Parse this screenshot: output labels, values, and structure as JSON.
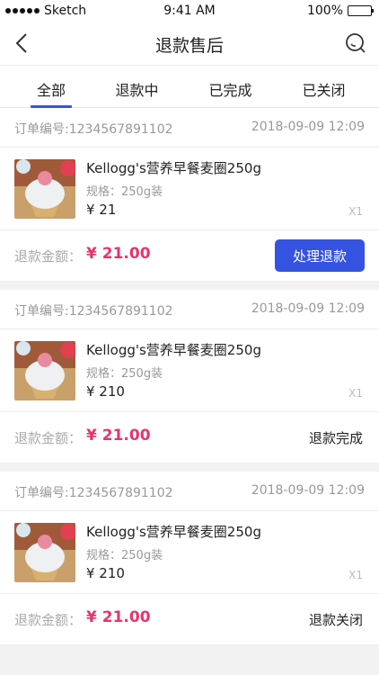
{
  "status_bar": {
    "carrier": "Sketch",
    "time": "9:41 AM",
    "battery": "100%"
  },
  "nav": {
    "title": "退款售后",
    "back_icon": "back-chevron-icon",
    "search_icon": "search-icon"
  },
  "tabs": [
    {
      "label": "全部",
      "active": true
    },
    {
      "label": "退款中",
      "active": false
    },
    {
      "label": "已完成",
      "active": false
    },
    {
      "label": "已关闭",
      "active": false
    }
  ],
  "orders": [
    {
      "order_no": "订单编号:1234567891102",
      "date": "2018-09-09 12:09",
      "product_name": "Kellogg's营养早餐麦圈250g",
      "spec": "规格：250g装",
      "price": "¥ 21",
      "qty": "X1",
      "refund_label": "退款金额：",
      "refund_amount": "¥ 21.00",
      "action_label": "处理退款"
    },
    {
      "order_no": "订单编号:1234567891102",
      "date": "2018-09-09 12:09",
      "product_name": "Kellogg's营养早餐麦圈250g",
      "spec": "规格：250g装",
      "price": "¥ 210",
      "qty": "X1",
      "refund_label": "退款金额：",
      "refund_amount": "¥ 21.00",
      "status": "退款完成"
    },
    {
      "order_no": "订单编号:1234567891102",
      "date": "2018-09-09 12:09",
      "product_name": "Kellogg's营养早餐麦圈250g",
      "spec": "规格：250g装",
      "price": "¥ 210",
      "qty": "X1",
      "refund_label": "退款金额：",
      "refund_amount": "¥ 21.00",
      "status": "退款关闭"
    }
  ],
  "colors": {
    "accent": "#3453e0",
    "price_red": "#e9326d"
  }
}
